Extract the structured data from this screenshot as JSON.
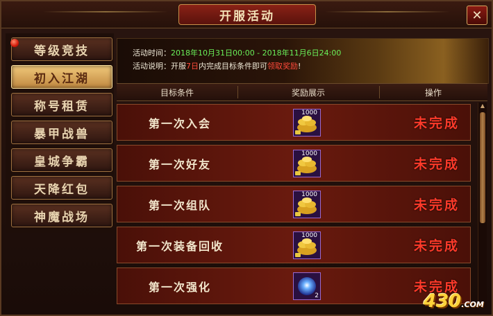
{
  "window": {
    "title": "开服活动",
    "close_label": "✕"
  },
  "sidebar": {
    "items": [
      {
        "label": "等级竞技",
        "active": false
      },
      {
        "label": "初入江湖",
        "active": true
      },
      {
        "label": "称号租赁",
        "active": false
      },
      {
        "label": "暴甲战兽",
        "active": false
      },
      {
        "label": "皇城争霸",
        "active": false
      },
      {
        "label": "天降红包",
        "active": false
      },
      {
        "label": "神魔战场",
        "active": false
      }
    ]
  },
  "banner": {
    "time_label": "活动时间：",
    "time_value": "2018年10月31日00:00 - 2018年11月6日24:00",
    "desc_label": "活动说明：开服",
    "desc_days": "7日",
    "desc_mid": "内完成目标条件即可",
    "desc_action": "领取奖励",
    "desc_end": "!"
  },
  "table": {
    "headers": [
      "目标条件",
      "奖励展示",
      "操作"
    ],
    "rows": [
      {
        "label": "第一次入会",
        "reward_icon": "gold-ingot-icon",
        "reward_qty": "1000",
        "status": "未完成"
      },
      {
        "label": "第一次好友",
        "reward_icon": "gold-ingot-icon",
        "reward_qty": "1000",
        "status": "未完成"
      },
      {
        "label": "第一次组队",
        "reward_icon": "gold-ingot-icon",
        "reward_qty": "1000",
        "status": "未完成"
      },
      {
        "label": "第一次装备回收",
        "reward_icon": "gold-ingot-icon",
        "reward_qty": "1000",
        "status": "未完成"
      },
      {
        "label": "第一次强化",
        "reward_icon": "blue-orb-icon",
        "reward_qty": "2",
        "status": "未完成"
      }
    ]
  },
  "watermark": {
    "text": "430",
    "suffix": ".COM"
  },
  "colors": {
    "accent_red": "#ff3a2a",
    "gold": "#f0c87a",
    "highlight_green": "#6af05a"
  }
}
